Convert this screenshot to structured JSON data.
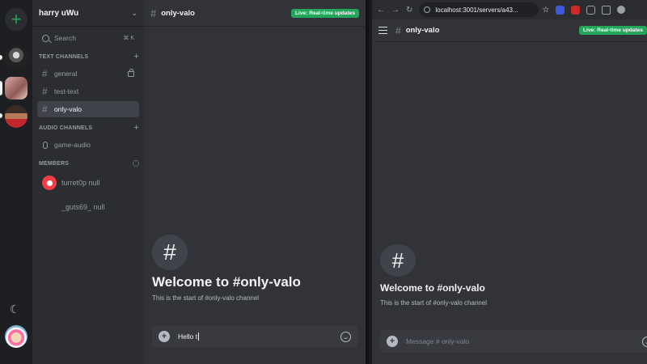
{
  "left": {
    "server_name": "harry uWu",
    "search": {
      "label": "Search",
      "shortcut": "⌘ K"
    },
    "text_channels_header": "TEXT CHANNELS",
    "text_channels": [
      {
        "label": "general",
        "locked": true
      },
      {
        "label": "test-text",
        "locked": false
      },
      {
        "label": "only-valo",
        "locked": false,
        "active": true
      }
    ],
    "audio_channels_header": "AUDIO CHANNELS",
    "audio_channels": [
      {
        "label": "game-audio"
      }
    ],
    "members_header": "MEMBERS",
    "members": [
      {
        "name": "turret0p null"
      },
      {
        "name": "_guts69_ null"
      }
    ],
    "chat": {
      "channel_title": "only-valo",
      "live_badge": "Live: Real-time updates",
      "welcome_title": "Welcome to #only-valo",
      "welcome_sub": "This is the start of #only-valo channel",
      "message_value": "Hello t"
    }
  },
  "browser": {
    "url": "localhost:3001/servers/a43...",
    "page": {
      "channel_title": "only-valo",
      "live_badge": "Live: Real-time updates",
      "welcome_title": "Welcome to #only-valo",
      "welcome_sub": "This is the start of #only-valo channel",
      "message_placeholder": "Message # only-valo"
    }
  },
  "colors": {
    "accent_green": "#23a55a",
    "background": "#313338",
    "sidebar": "#2b2d31",
    "rail": "#1e1f22"
  }
}
